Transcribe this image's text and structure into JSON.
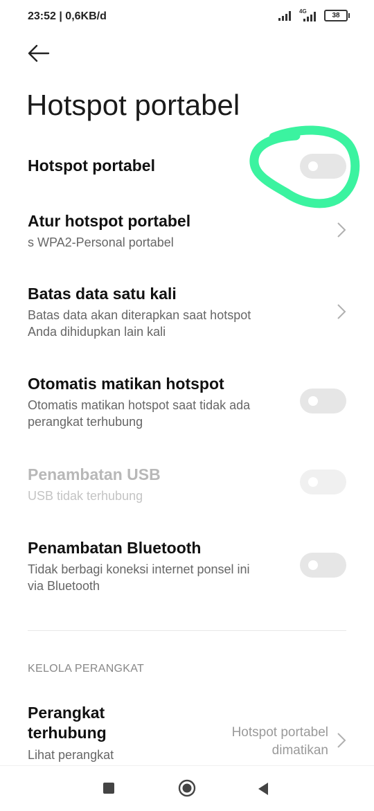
{
  "status": {
    "time": "23:52 | 0,6KB/d",
    "battery": "38",
    "network": "4G"
  },
  "header": {
    "title": "Hotspot portabel"
  },
  "settings": [
    {
      "title": "Hotspot portabel"
    },
    {
      "title": "Atur hotspot portabel",
      "subtitle": "s WPA2-Personal portabel"
    },
    {
      "title": "Batas data satu kali",
      "subtitle_line1": "Batas data akan diterapkan saat hotspot",
      "subtitle_line2": "Anda dihidupkan lain kali"
    },
    {
      "title": "Otomatis matikan hotspot",
      "subtitle_line1": "Otomatis matikan hotspot saat tidak ada",
      "subtitle_line2": "perangkat terhubung"
    },
    {
      "title": "Penambatan USB",
      "subtitle": "USB tidak terhubung"
    },
    {
      "title": "Penambatan Bluetooth",
      "subtitle_line1": "Tidak berbagi koneksi internet ponsel ini",
      "subtitle_line2": "via Bluetooth"
    }
  ],
  "section": {
    "header": "KELOLA PERANGKAT"
  },
  "devices": {
    "title_line1": "Perangkat",
    "title_line2": "terhubung",
    "subtitle": "Lihat perangkat",
    "value_line1": "Hotspot portabel",
    "value_line2": "dimatikan"
  },
  "colors": {
    "annotation": "#3bf3a0",
    "toggle_off": "#e6e6e6"
  }
}
